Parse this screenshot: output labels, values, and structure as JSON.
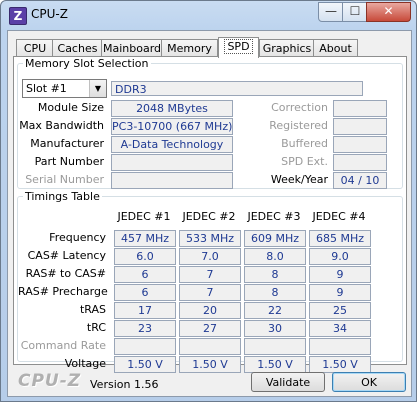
{
  "window": {
    "title": "CPU-Z",
    "app_icon": "Z",
    "minimize": "—",
    "maximize": "☐",
    "close": "✕"
  },
  "tabs": [
    "CPU",
    "Caches",
    "Mainboard",
    "Memory",
    "SPD",
    "Graphics",
    "About"
  ],
  "active_tab": "SPD",
  "slot_selection": {
    "legend": "Memory Slot Selection",
    "selected_slot": "Slot #1",
    "memory_type": "DDR3",
    "module_size": {
      "label": "Module Size",
      "value": "2048 MBytes"
    },
    "max_bandwidth": {
      "label": "Max Bandwidth",
      "value": "PC3-10700 (667 MHz)"
    },
    "manufacturer": {
      "label": "Manufacturer",
      "value": "A-Data Technology"
    },
    "part_number": {
      "label": "Part Number",
      "value": ""
    },
    "serial_number": {
      "label": "Serial Number",
      "value": ""
    },
    "correction": {
      "label": "Correction",
      "value": ""
    },
    "registered": {
      "label": "Registered",
      "value": ""
    },
    "buffered": {
      "label": "Buffered",
      "value": ""
    },
    "spd_ext": {
      "label": "SPD Ext.",
      "value": ""
    },
    "week_year": {
      "label": "Week/Year",
      "value": "04 / 10"
    }
  },
  "timings": {
    "legend": "Timings Table",
    "columns": [
      "JEDEC #1",
      "JEDEC #2",
      "JEDEC #3",
      "JEDEC #4"
    ],
    "rows": [
      {
        "label": "Frequency",
        "values": [
          "457 MHz",
          "533 MHz",
          "609 MHz",
          "685 MHz"
        ]
      },
      {
        "label": "CAS# Latency",
        "values": [
          "6.0",
          "7.0",
          "8.0",
          "9.0"
        ]
      },
      {
        "label": "RAS# to CAS#",
        "values": [
          "6",
          "7",
          "8",
          "9"
        ]
      },
      {
        "label": "RAS# Precharge",
        "values": [
          "6",
          "7",
          "8",
          "9"
        ]
      },
      {
        "label": "tRAS",
        "values": [
          "17",
          "20",
          "22",
          "25"
        ]
      },
      {
        "label": "tRC",
        "values": [
          "23",
          "27",
          "30",
          "34"
        ]
      },
      {
        "label": "Command Rate",
        "values": [
          "",
          "",
          "",
          ""
        ],
        "dim": true
      },
      {
        "label": "Voltage",
        "values": [
          "1.50 V",
          "1.50 V",
          "1.50 V",
          "1.50 V"
        ]
      }
    ]
  },
  "footer": {
    "brand": "CPU-Z",
    "version": "Version 1.56",
    "validate": "Validate",
    "ok": "OK"
  }
}
